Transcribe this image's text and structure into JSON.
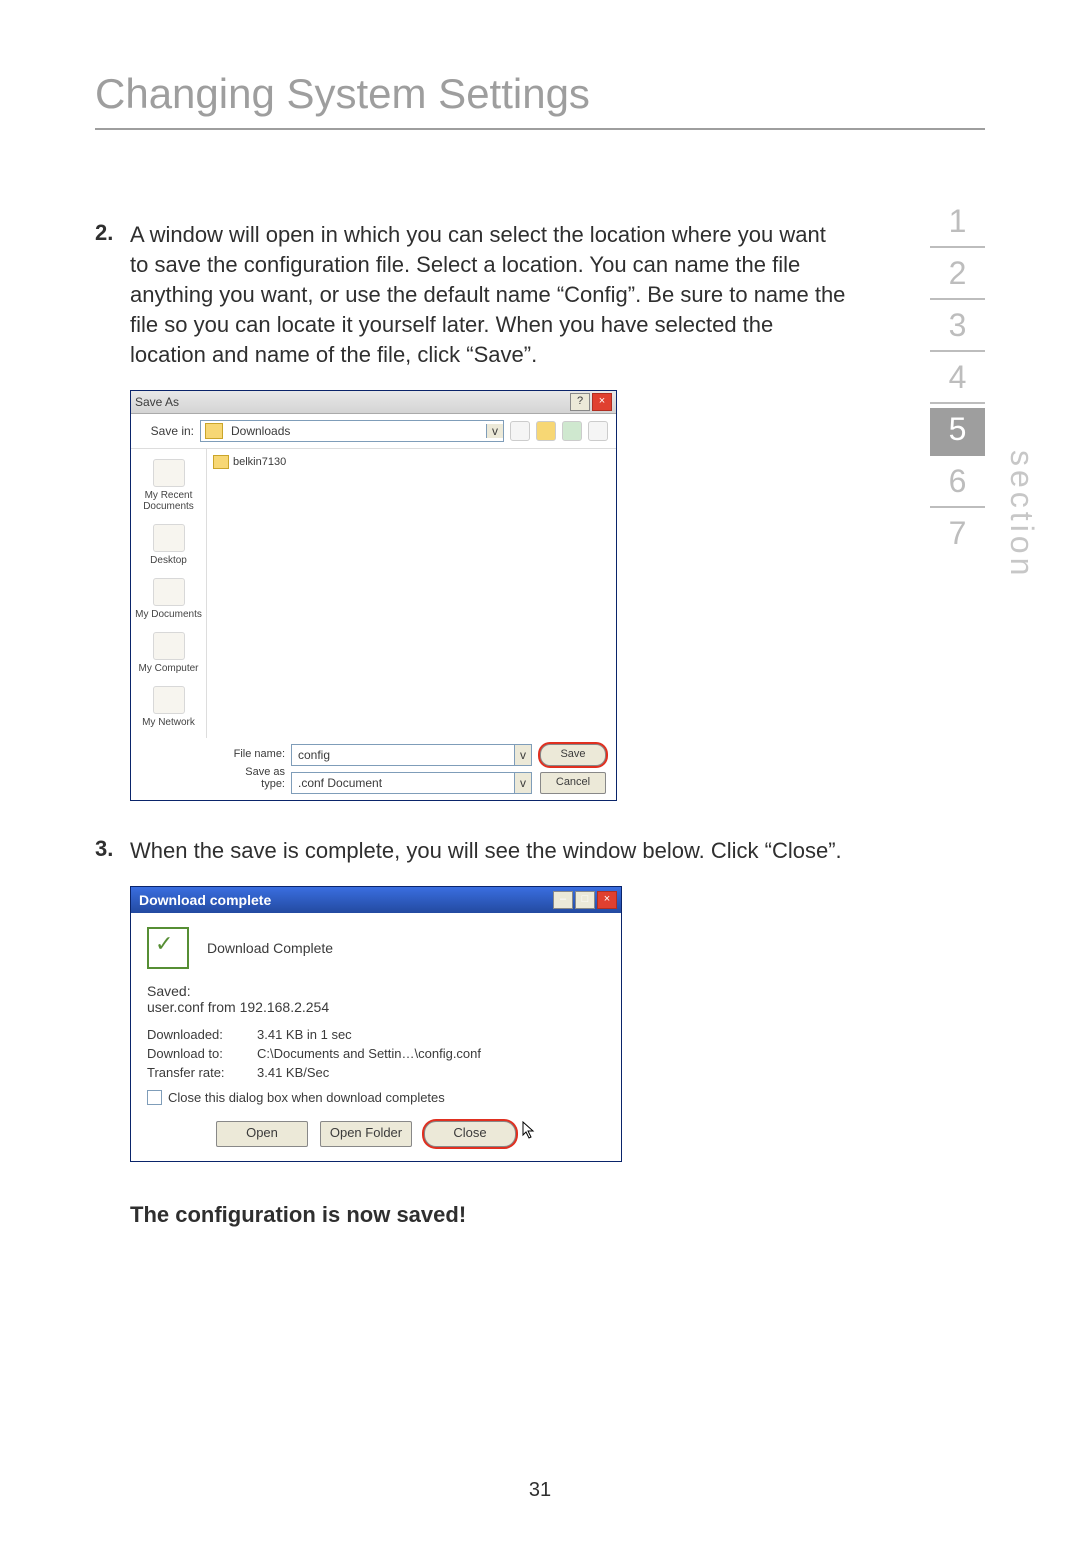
{
  "page": {
    "title": "Changing System Settings",
    "number": "31",
    "section_label": "section"
  },
  "nav": {
    "items": [
      "1",
      "2",
      "3",
      "4",
      "5",
      "6",
      "7"
    ],
    "active": "5"
  },
  "step2": {
    "num": "2.",
    "text": "A window will open in which you can select the location where you want to save the configuration file. Select a location. You can name the file anything you want, or use the default name “Config”. Be sure to name the file so you can locate it yourself later. When you have selected the location and name of the file, click “Save”."
  },
  "step3": {
    "num": "3.",
    "text": "When the save is complete, you will see the window below. Click “Close”."
  },
  "confirm_text": "The configuration is now saved!",
  "saveas": {
    "title": "Save As",
    "help_btn": "?",
    "close_btn": "×",
    "savein_label": "Save in:",
    "savein_value": "Downloads",
    "file_item": "belkin7130",
    "places": [
      "My Recent Documents",
      "Desktop",
      "My Documents",
      "My Computer",
      "My Network"
    ],
    "filename_label": "File name:",
    "filename_value": "config",
    "saveastype_label": "Save as type:",
    "saveastype_value": ".conf Document",
    "save_btn": "Save",
    "cancel_btn": "Cancel",
    "dropdown_arrow": "v"
  },
  "dlc": {
    "title": "Download complete",
    "min_btn": "–",
    "max_btn": "□",
    "close_btn": "×",
    "heading": "Download Complete",
    "saved_label": "Saved:",
    "saved_value": "user.conf from 192.168.2.254",
    "downloaded_label": "Downloaded:",
    "downloaded_value": "3.41 KB in 1 sec",
    "downloadto_label": "Download to:",
    "downloadto_value": "C:\\Documents and Settin…\\config.conf",
    "rate_label": "Transfer rate:",
    "rate_value": "3.41 KB/Sec",
    "checkbox_label": "Close this dialog box when download completes",
    "open_btn": "Open",
    "openfolder_btn": "Open Folder",
    "close_dlg_btn": "Close"
  }
}
